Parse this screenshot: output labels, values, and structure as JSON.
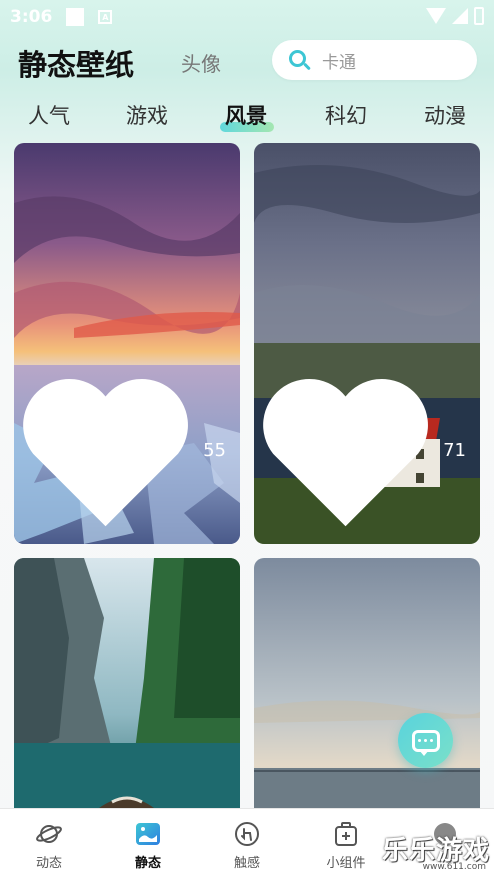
{
  "status_bar": {
    "time": "3:06",
    "a_icon": "A"
  },
  "header": {
    "title": "静态壁纸",
    "sub_tab": "头像",
    "search_placeholder": "卡通"
  },
  "categories": [
    {
      "label": "人气",
      "active": false
    },
    {
      "label": "游戏",
      "active": false
    },
    {
      "label": "风景",
      "active": true
    },
    {
      "label": "科幻",
      "active": false
    },
    {
      "label": "动漫",
      "active": false
    }
  ],
  "wallpapers": [
    {
      "likes": "55",
      "scene": "sunset-ice"
    },
    {
      "likes": "71",
      "scene": "red-roof-house"
    },
    {
      "likes": "",
      "scene": "green-canyon-lake"
    },
    {
      "likes": "",
      "scene": "calm-sea-dusk"
    }
  ],
  "fab": {
    "icon": "chat-bubble-icon"
  },
  "bottom_nav": [
    {
      "label": "动态",
      "icon": "planet-icon",
      "active": false
    },
    {
      "label": "静态",
      "icon": "image-icon",
      "active": true
    },
    {
      "label": "触感",
      "icon": "touch-icon",
      "active": false
    },
    {
      "label": "小组件",
      "icon": "widget-icon",
      "active": false
    },
    {
      "label": "",
      "icon": "profile-icon",
      "active": false
    }
  ],
  "watermark": {
    "text": "乐乐游戏",
    "url": "www.611.com"
  },
  "colors": {
    "accent": "#3dc6d4",
    "fab_start": "#59d3dd",
    "fab_end": "#7ae0c9"
  }
}
